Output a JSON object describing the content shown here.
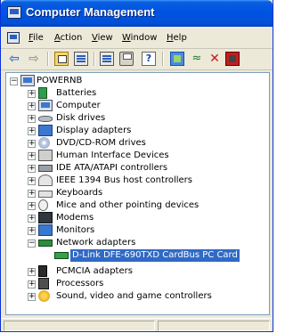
{
  "window": {
    "title": "Computer Management"
  },
  "menu": {
    "items": [
      {
        "label": "File",
        "accel": "F",
        "rest": "ile"
      },
      {
        "label": "Action",
        "accel": "A",
        "rest": "ction"
      },
      {
        "label": "View",
        "accel": "V",
        "rest": "iew"
      },
      {
        "label": "Window",
        "accel": "W",
        "rest": "indow"
      },
      {
        "label": "Help",
        "accel": "H",
        "rest": "elp"
      }
    ]
  },
  "toolbar": {
    "icons": [
      "back-arrow-icon",
      "forward-arrow-icon",
      "up-folder-icon",
      "show-hide-tree-icon",
      "properties-icon",
      "print-icon",
      "help-icon",
      "scan-hardware-icon",
      "update-driver-icon",
      "uninstall-icon",
      "disable-icon"
    ]
  },
  "tree": {
    "root": "POWERNB",
    "categories": [
      {
        "label": "Batteries",
        "icon": "battery-icon"
      },
      {
        "label": "Computer",
        "icon": "computer-icon"
      },
      {
        "label": "Disk drives",
        "icon": "disk-drive-icon"
      },
      {
        "label": "Display adapters",
        "icon": "display-adapter-icon"
      },
      {
        "label": "DVD/CD-ROM drives",
        "icon": "dvd-drive-icon"
      },
      {
        "label": "Human Interface Devices",
        "icon": "hid-icon"
      },
      {
        "label": "IDE ATA/ATAPI controllers",
        "icon": "ide-controller-icon"
      },
      {
        "label": "IEEE 1394 Bus host controllers",
        "icon": "ieee1394-icon"
      },
      {
        "label": "Keyboards",
        "icon": "keyboard-icon"
      },
      {
        "label": "Mice and other pointing devices",
        "icon": "mouse-icon"
      },
      {
        "label": "Modems",
        "icon": "modem-icon"
      },
      {
        "label": "Monitors",
        "icon": "monitor-icon"
      },
      {
        "label": "Network adapters",
        "icon": "network-adapter-icon"
      }
    ],
    "network_child": "D-Link DFE-690TXD CardBus PC Card",
    "more_categories": [
      {
        "label": "PCMCIA adapters",
        "icon": "pcmcia-icon"
      },
      {
        "label": "Processors",
        "icon": "processor-icon"
      },
      {
        "label": "Sound, video and game controllers",
        "icon": "sound-icon"
      }
    ],
    "expand_symbol": "+",
    "collapse_symbol": "−"
  },
  "colors": {
    "title_bar": "#0054e3",
    "selection": "#316ac5",
    "chrome": "#ece9d8"
  }
}
